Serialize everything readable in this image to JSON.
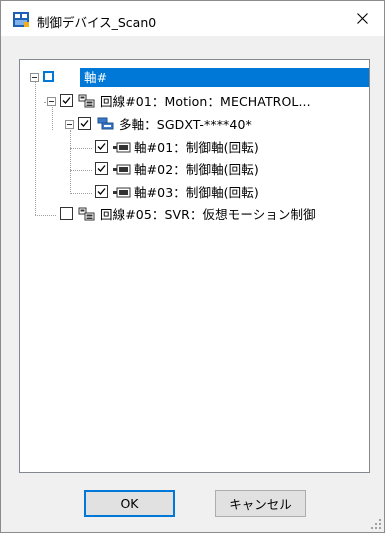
{
  "window": {
    "title": "制御デバイス_Scan0"
  },
  "tree": {
    "root": {
      "label": "軸#"
    },
    "line1": {
      "label": "回線#01：Motion：MECHATROL..."
    },
    "multi_axis": {
      "label": "多軸：SGDXT-****40*"
    },
    "axes": [
      {
        "label": "軸#01：制御軸(回転)"
      },
      {
        "label": "軸#02：制御軸(回転)"
      },
      {
        "label": "軸#03：制御軸(回転)"
      }
    ],
    "line5": {
      "label": "回線#05：SVR：仮想モーション制御"
    }
  },
  "buttons": {
    "ok": "OK",
    "cancel": "キャンセル"
  },
  "colors": {
    "selection": "#0078d7",
    "dialog_bg": "#f0f0f0"
  }
}
